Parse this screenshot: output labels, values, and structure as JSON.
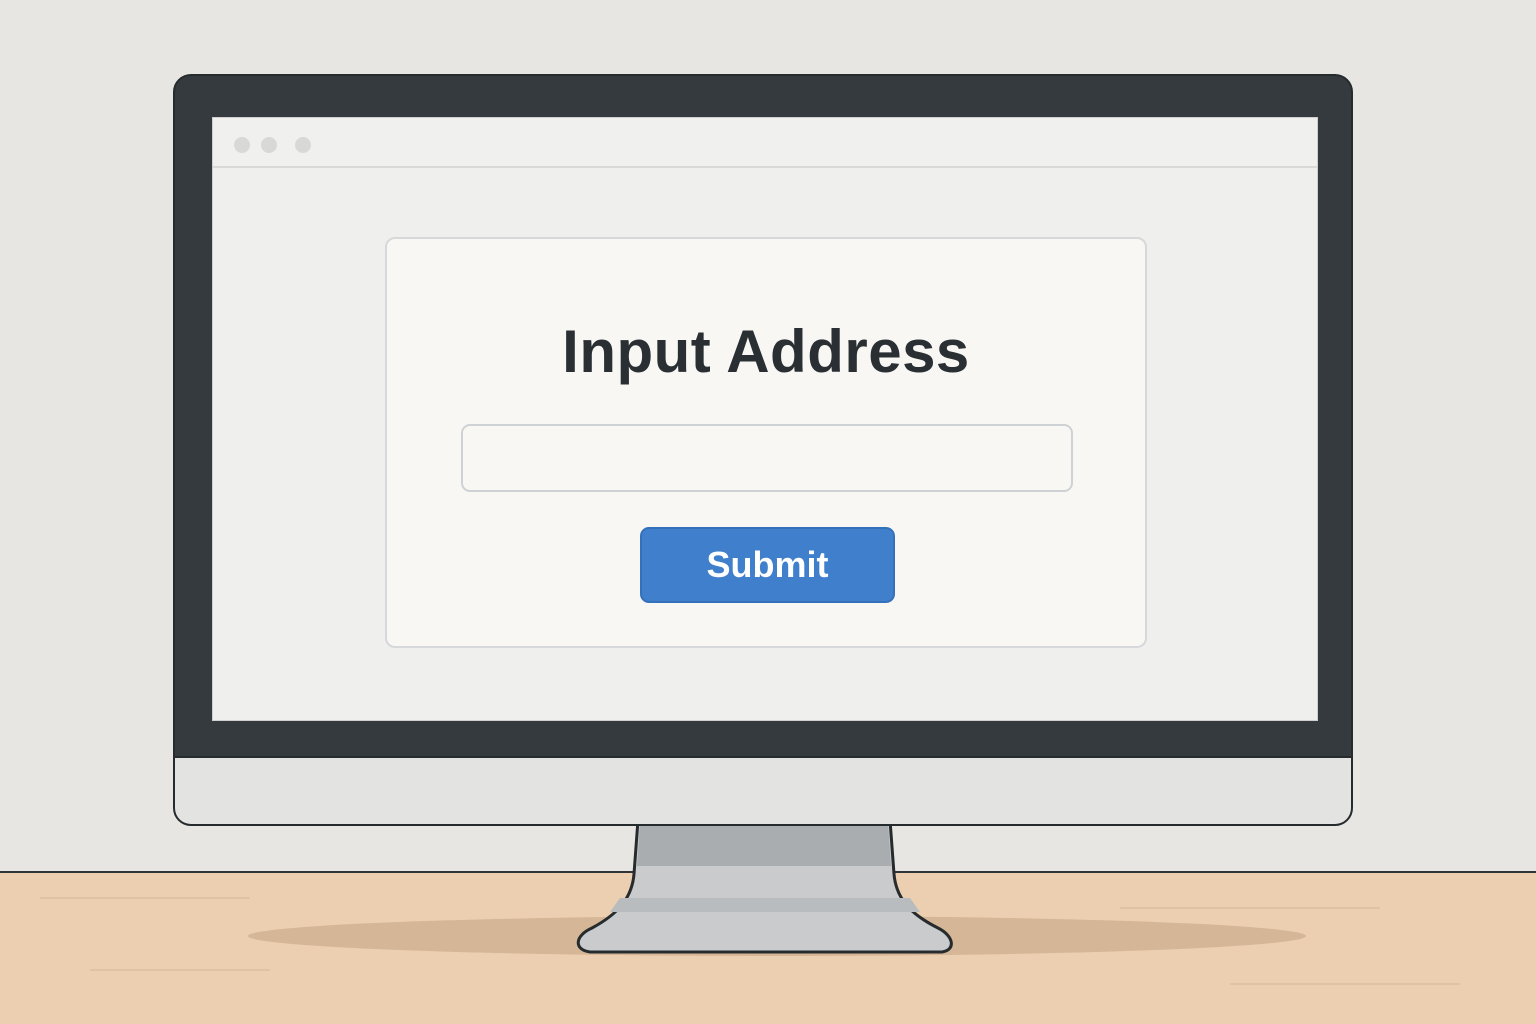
{
  "window": {
    "controls": [
      "window-dot",
      "window-dot",
      "window-dot"
    ]
  },
  "form": {
    "title": "Input Address",
    "input_value": "",
    "input_placeholder": "",
    "submit_label": "Submit"
  },
  "colors": {
    "accent": "#3f7fcc",
    "title_text": "#2a2f33",
    "monitor_bezel": "#343a3e",
    "desk": "#ebcfb0"
  }
}
